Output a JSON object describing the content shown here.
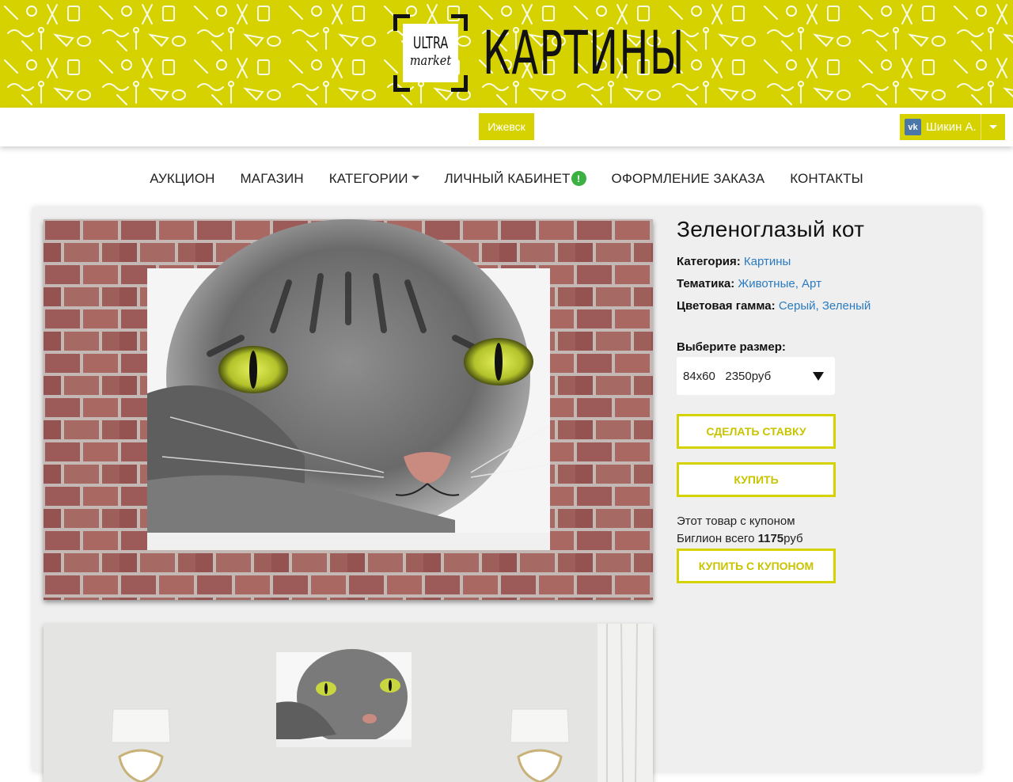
{
  "header": {
    "logo_top": "ULTRA",
    "logo_bottom": "market",
    "title": "КАРТИНЫ",
    "banner_color": "#d6d200"
  },
  "topbar": {
    "city": "Ижевск",
    "user_name": "Шикин А.",
    "user_icon": "vk-icon"
  },
  "nav": {
    "items": [
      {
        "label": "АУКЦИОН"
      },
      {
        "label": "МАГАЗИН"
      },
      {
        "label": "КАТЕГОРИИ"
      },
      {
        "label": "ЛИЧНЫЙ КАБИНЕТ"
      },
      {
        "label": "ОФОРМЛЕНИЕ ЗАКАЗА"
      },
      {
        "label": "КОНТАКТЫ"
      }
    ],
    "alert_glyph": "!"
  },
  "product": {
    "title": "Зеленоглазый кот",
    "category_label": "Категория:",
    "category_value": "Картины",
    "theme_label": "Тематика:",
    "theme_value": "Животные, Арт",
    "color_label": "Цветовая гамма:",
    "color_value": "Серый, Зеленый",
    "size_label": "Выберите размер:",
    "size_selected": "84x60   2350руб",
    "bid_button": "СДЕЛАТЬ СТАВКУ",
    "buy_button": "КУПИТЬ",
    "coupon_line1": "Этот товар с купоном",
    "coupon_line2_prefix": "Биглион всего ",
    "coupon_price": "1175",
    "coupon_line2_suffix": "руб",
    "coupon_button": "КУПИТЬ С КУПОНОМ"
  },
  "colors": {
    "accent": "#d6d200",
    "link": "#2a7bc0",
    "alert": "#3cb043"
  }
}
